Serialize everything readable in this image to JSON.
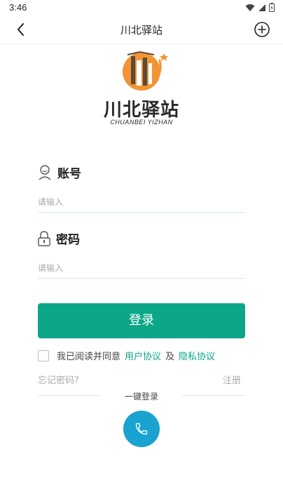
{
  "status_bar": {
    "time": "3:46"
  },
  "nav": {
    "title": "川北驿站"
  },
  "logo": {
    "name_cn": "川北驿站",
    "name_en": "CHUANBEI YIZHAN"
  },
  "account": {
    "label": "账号",
    "placeholder": "请输入",
    "value": ""
  },
  "password": {
    "label": "密码",
    "placeholder": "请输入",
    "value": ""
  },
  "login_button": {
    "label": "登录"
  },
  "agreement": {
    "checked": false,
    "text": "我已阅读并同意",
    "user_agreement": "用户协议",
    "and": "及",
    "privacy_policy": "隐私协议"
  },
  "forgot_password": "忘记密码?",
  "register": "注册",
  "quick_login": {
    "label": "一键登录",
    "icon": "phone-icon"
  },
  "colors": {
    "accent": "#0ca688",
    "phone_button": "#1aa3d0",
    "logo_orange": "#f39432"
  }
}
